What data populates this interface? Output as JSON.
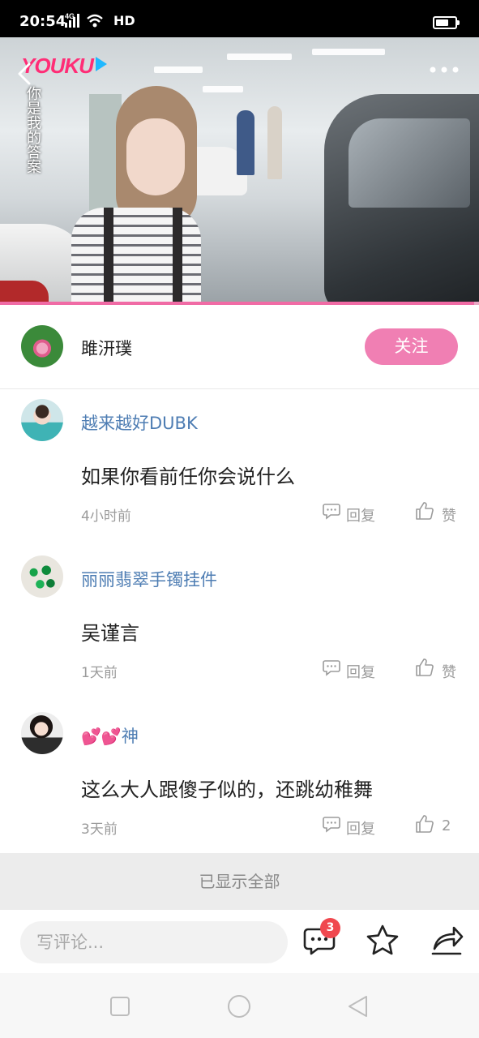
{
  "status_bar": {
    "time": "20:54",
    "network": "4G",
    "hd": "HD",
    "battery_level": 0.7
  },
  "video": {
    "logo": "YOUKU",
    "title_vertical": "你是我的答案",
    "progress": 0.99,
    "accent_color": "#f06ba5"
  },
  "author": {
    "name": "雎汧璞",
    "follow_label": "关注",
    "follow_color": "#f07fb3"
  },
  "comments": [
    {
      "user": "越来越好DUBK",
      "text": "如果你看前任你会说什么",
      "time": "4小时前",
      "reply_label": "回复",
      "like_label": "赞"
    },
    {
      "user": "丽丽翡翠手镯挂件",
      "text": "吴谨言",
      "time": "1天前",
      "reply_label": "回复",
      "like_label": "赞"
    },
    {
      "user_emoji": "💕💕",
      "user": "神",
      "text": "这么大人跟傻子似的，还跳幼稚舞",
      "time": "3天前",
      "reply_label": "回复",
      "like_label": "2"
    }
  ],
  "all_shown": "已显示全部",
  "bottom_bar": {
    "placeholder": "写评论...",
    "comment_badge": "3"
  },
  "icons": {
    "back": "chevron-left-icon",
    "more": "more-dots-icon",
    "reply": "comment-bubble-icon",
    "like": "thumbs-up-icon",
    "comments": "chat-icon",
    "favorite": "star-icon",
    "share": "share-icon"
  }
}
